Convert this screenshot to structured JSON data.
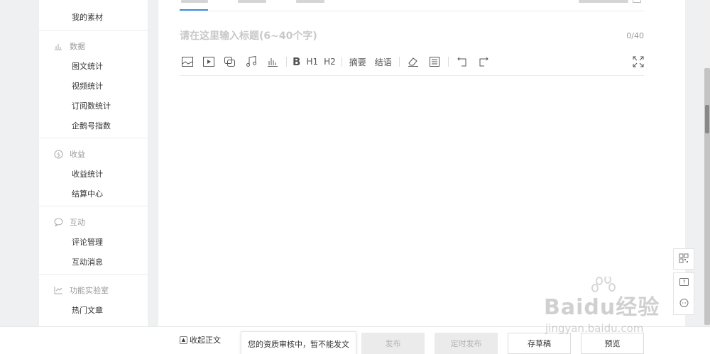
{
  "sidebar": {
    "top_item": "我的素材",
    "groups": [
      {
        "icon": "bar-chart-icon",
        "label": "数据",
        "items": [
          "图文统计",
          "视频统计",
          "订阅数统计",
          "企鹅号指数"
        ]
      },
      {
        "icon": "dollar-circle-icon",
        "label": "收益",
        "items": [
          "收益统计",
          "结算中心"
        ]
      },
      {
        "icon": "chat-bubble-icon",
        "label": "互动",
        "items": [
          "评论管理",
          "互动消息"
        ]
      },
      {
        "icon": "lab-chart-icon",
        "label": "功能实验室",
        "items": [
          "热门文章"
        ]
      }
    ]
  },
  "editor": {
    "title_placeholder": "请在这里输入标题(6~40个字)",
    "counter": "0/40",
    "toolbar": {
      "bold": "B",
      "h1": "H1",
      "h2": "H2",
      "summary": "摘要",
      "conclusion": "结语"
    }
  },
  "bottom": {
    "collapse_label": "收起正文",
    "tooltip": "您的资质审核中，暂不能发文",
    "publish": "发布",
    "schedule": "定时发布",
    "save_draft": "存草稿",
    "preview": "预览"
  },
  "watermark": {
    "brand": "Baidu经验",
    "url": "jingyan.baidu.com"
  },
  "colors": {
    "accent": "#3b8de0",
    "background": "#eef0f2",
    "disabled": "#ebebeb"
  }
}
